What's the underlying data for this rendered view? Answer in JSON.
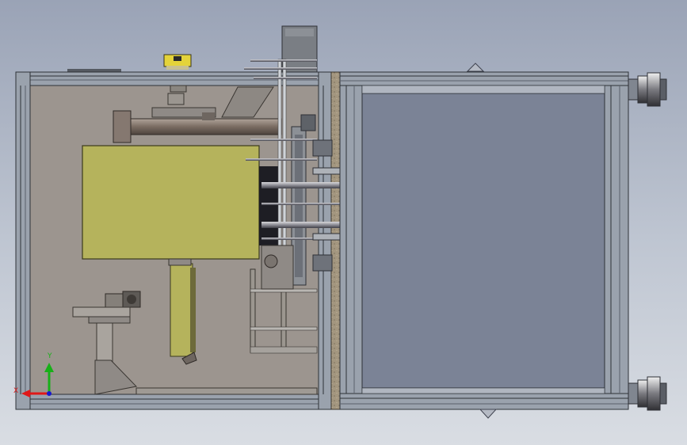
{
  "triad": {
    "x_label": "X",
    "y_label": "Y",
    "x_color": "#e01818",
    "y_color": "#18b018",
    "z_color": "#1818d0"
  },
  "colors": {
    "frame": "#8f98a4",
    "frame_dark": "#3c4048",
    "panel_left": "#9a948f",
    "panel_right": "#7b8396",
    "yellow_block": "#b4b35b",
    "wood_strip": "#a89a83",
    "cylinder": "#8a7b70",
    "yellow_part": "#e4d33a"
  }
}
